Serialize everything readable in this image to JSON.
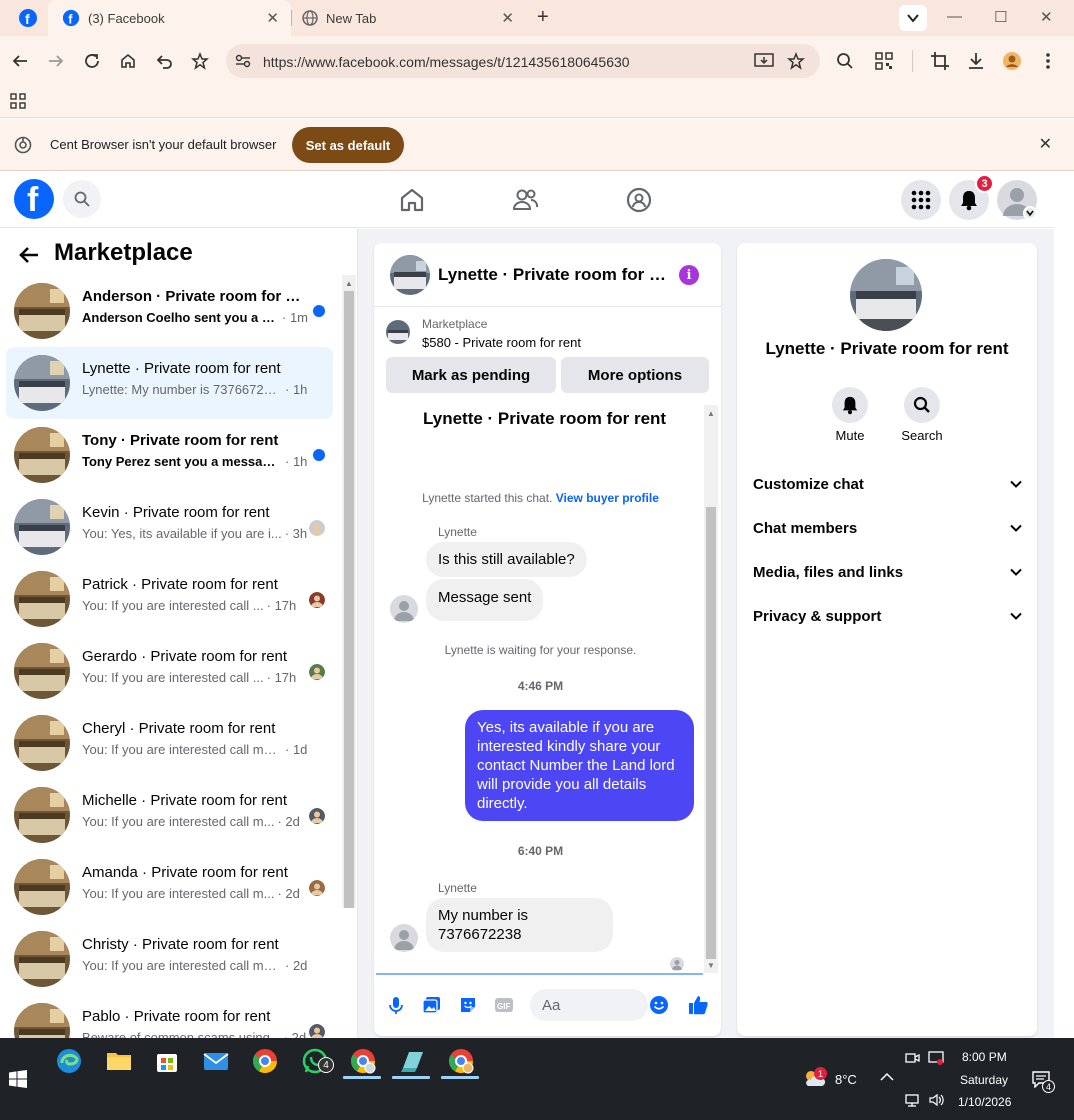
{
  "browser": {
    "tabs": [
      {
        "label": "(3) Facebook",
        "active": true
      },
      {
        "label": "New Tab",
        "active": false
      }
    ],
    "url": "https://www.facebook.com/messages/t/1214356180645630",
    "infobar": {
      "message": "Cent Browser isn't your default browser",
      "button": "Set as default"
    }
  },
  "facebook": {
    "notification_count": "3",
    "logo_letter": "f"
  },
  "left_panel": {
    "title": "Marketplace",
    "conversations": [
      {
        "name": "Anderson · Private room for re...",
        "preview": "Anderson Coelho sent you a m...",
        "time": "· 1m",
        "unread": true,
        "active": false
      },
      {
        "name": "Lynette · Private room for rent",
        "preview": "Lynette: My number is 7376672238",
        "time": "· 1h",
        "unread": false,
        "active": true
      },
      {
        "name": "Tony · Private room for rent",
        "preview": "Tony Perez sent you a message ...",
        "time": "· 1h",
        "unread": true,
        "active": false
      },
      {
        "name": "Kevin · Private room for rent",
        "preview": "You: Yes, its available if you are i...",
        "time": "· 3h",
        "unread": false,
        "active": false
      },
      {
        "name": "Patrick · Private room for rent",
        "preview": "You: If you are interested call ...",
        "time": "· 17h",
        "unread": false,
        "active": false
      },
      {
        "name": "Gerardo · Private room for rent",
        "preview": "You: If you are interested call ...",
        "time": "· 17h",
        "unread": false,
        "active": false
      },
      {
        "name": "Cheryl · Private room for rent",
        "preview": "You: If you are interested call me at...",
        "time": "· 1d",
        "unread": false,
        "active": false
      },
      {
        "name": "Michelle · Private room for rent",
        "preview": "You: If you are interested call m...",
        "time": "· 2d",
        "unread": false,
        "active": false
      },
      {
        "name": "Amanda · Private room for rent",
        "preview": "You: If you are interested call m...",
        "time": "· 2d",
        "unread": false,
        "active": false
      },
      {
        "name": "Christy · Private room for rent",
        "preview": "You: If you are interested call me at...",
        "time": "· 2d",
        "unread": false,
        "active": false
      },
      {
        "name": "Pablo · Private room for rent",
        "preview": "Beware of common scams using...",
        "time": "· 2d",
        "unread": false,
        "active": false
      }
    ]
  },
  "chat": {
    "title": "Lynette · Private room for r...",
    "marketplace_label": "Marketplace",
    "listing": "$580 - Private room for rent",
    "mark_pending": "Mark as pending",
    "more_options": "More options",
    "thread_name": "Lynette · Private room for rent",
    "started_text": "Lynette started this chat.",
    "view_profile": "View buyer profile",
    "sender_1": "Lynette",
    "msg_1": "Is this still available?",
    "msg_2": "Message sent",
    "waiting": "Lynette is waiting for your response.",
    "time_1": "4:46 PM",
    "msg_out": "Yes, its available if you are interested kindly share your contact Number the Land lord will provide you all details directly.",
    "time_2": "6:40 PM",
    "sender_2": "Lynette",
    "msg_3": "My number is 7376672238",
    "composer_placeholder": "Aa"
  },
  "right_panel": {
    "name": "Lynette · Private room for rent",
    "mute": "Mute",
    "search": "Search",
    "sections": [
      "Customize chat",
      "Chat members",
      "Media, files and links",
      "Privacy & support"
    ]
  },
  "taskbar": {
    "weather": "8°C",
    "time": "8:00 PM",
    "day": "Saturday",
    "date": "1/10/2026",
    "whatsapp_badge": "4",
    "notif_badge": "4",
    "weather_badge": "1"
  },
  "colors": {
    "facebook_blue": "#0866ff",
    "outgoing_bubble": "#4d46f5",
    "info_purple": "#a933dc",
    "unread_dot": "#0866ff",
    "badge_red": "#e41e3f",
    "set_default": "#7c4a14"
  }
}
